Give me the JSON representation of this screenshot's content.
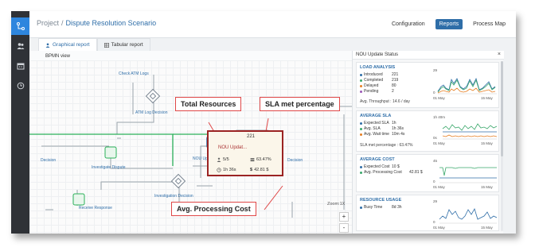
{
  "breadcrumb": {
    "root": "Project",
    "separator": "/",
    "current": "Dispute Resolution Scenario"
  },
  "top_nav": [
    {
      "label": "Configuration",
      "active": false
    },
    {
      "label": "Reports",
      "active": true
    },
    {
      "label": "Process Map",
      "active": false
    }
  ],
  "report_tabs": [
    {
      "label": "Graphical report",
      "icon": "person-icon",
      "active": true
    },
    {
      "label": "Tabular report",
      "icon": "table-icon",
      "active": false
    }
  ],
  "canvas": {
    "label": "BPMN view",
    "nodes": {
      "check_atm_logs": "Check ATM Logs",
      "atm_log_decision": "ATM Log Decision",
      "nou_update": "NOU Update St",
      "decision": "Decision",
      "investigate_dispute": "Investigate Dispute",
      "investigation_decision": "Investigation Decision",
      "receive_response": "Receive Response",
      "left_decision": "Decision"
    },
    "popup": {
      "count": "221",
      "title": "NOU Updat...",
      "staff": "5/5",
      "percentage": "63.47%",
      "time": "1h 36s",
      "cost_symbol": "$",
      "cost": "42.81 $"
    },
    "zoom": "Zoom:1X",
    "zoom_in": "+",
    "zoom_out": "-"
  },
  "callouts": {
    "resources": "Total Resources",
    "sla": "SLA  met percentage",
    "cost": "Avg. Processing Cost"
  },
  "panel": {
    "title": "NOU Update Status",
    "close": "×",
    "load": {
      "title": "LOAD ANALYSIS",
      "metrics": [
        {
          "label": "Introduced",
          "value": "221",
          "color": "#2f6ea8"
        },
        {
          "label": "Completed",
          "value": "219",
          "color": "#3aa86b"
        },
        {
          "label": "Delayed",
          "value": "80",
          "color": "#e67e22"
        },
        {
          "label": "Pending",
          "value": "2",
          "color": "#9b59b6"
        }
      ],
      "footer": "Avg. Throughput : 14.6 / day",
      "y_top": "29",
      "y_bottom": "0",
      "x_start": "01 May",
      "x_end": "15 May"
    },
    "sla": {
      "title": "AVERAGE SLA",
      "metrics": [
        {
          "label": "Expected SLA",
          "value": "1h",
          "color": "#2f6ea8"
        },
        {
          "label": "Avg. SLA",
          "value": "1h 36s",
          "color": "#3aa86b"
        },
        {
          "label": "Avg. Wait time",
          "value": "10m 4s",
          "color": "#e67e22"
        }
      ],
      "footer": "SLA met percentage : 63.47%",
      "y_top": "1h 40m",
      "y_bottom": "0s",
      "x_start": "01 May",
      "x_end": "15 May"
    },
    "cost": {
      "title": "AVERAGE COST",
      "metrics": [
        {
          "label": "Expected Cost",
          "value": "10 $",
          "color": "#2f6ea8"
        },
        {
          "label": "Avg. Processing Cost",
          "value": "42.81 $",
          "color": "#3aa86b"
        }
      ],
      "y_top": "45",
      "y_bottom": "0",
      "x_start": "01 May",
      "x_end": "15 May"
    },
    "resource": {
      "title": "RESOURCE USAGE",
      "metrics": [
        {
          "label": "Busy Time",
          "value": "8d 3h",
          "color": "#2f6ea8"
        }
      ],
      "y_top": "29",
      "y_bottom": "0",
      "x_start": "01 May",
      "x_end": "15 May"
    }
  }
}
